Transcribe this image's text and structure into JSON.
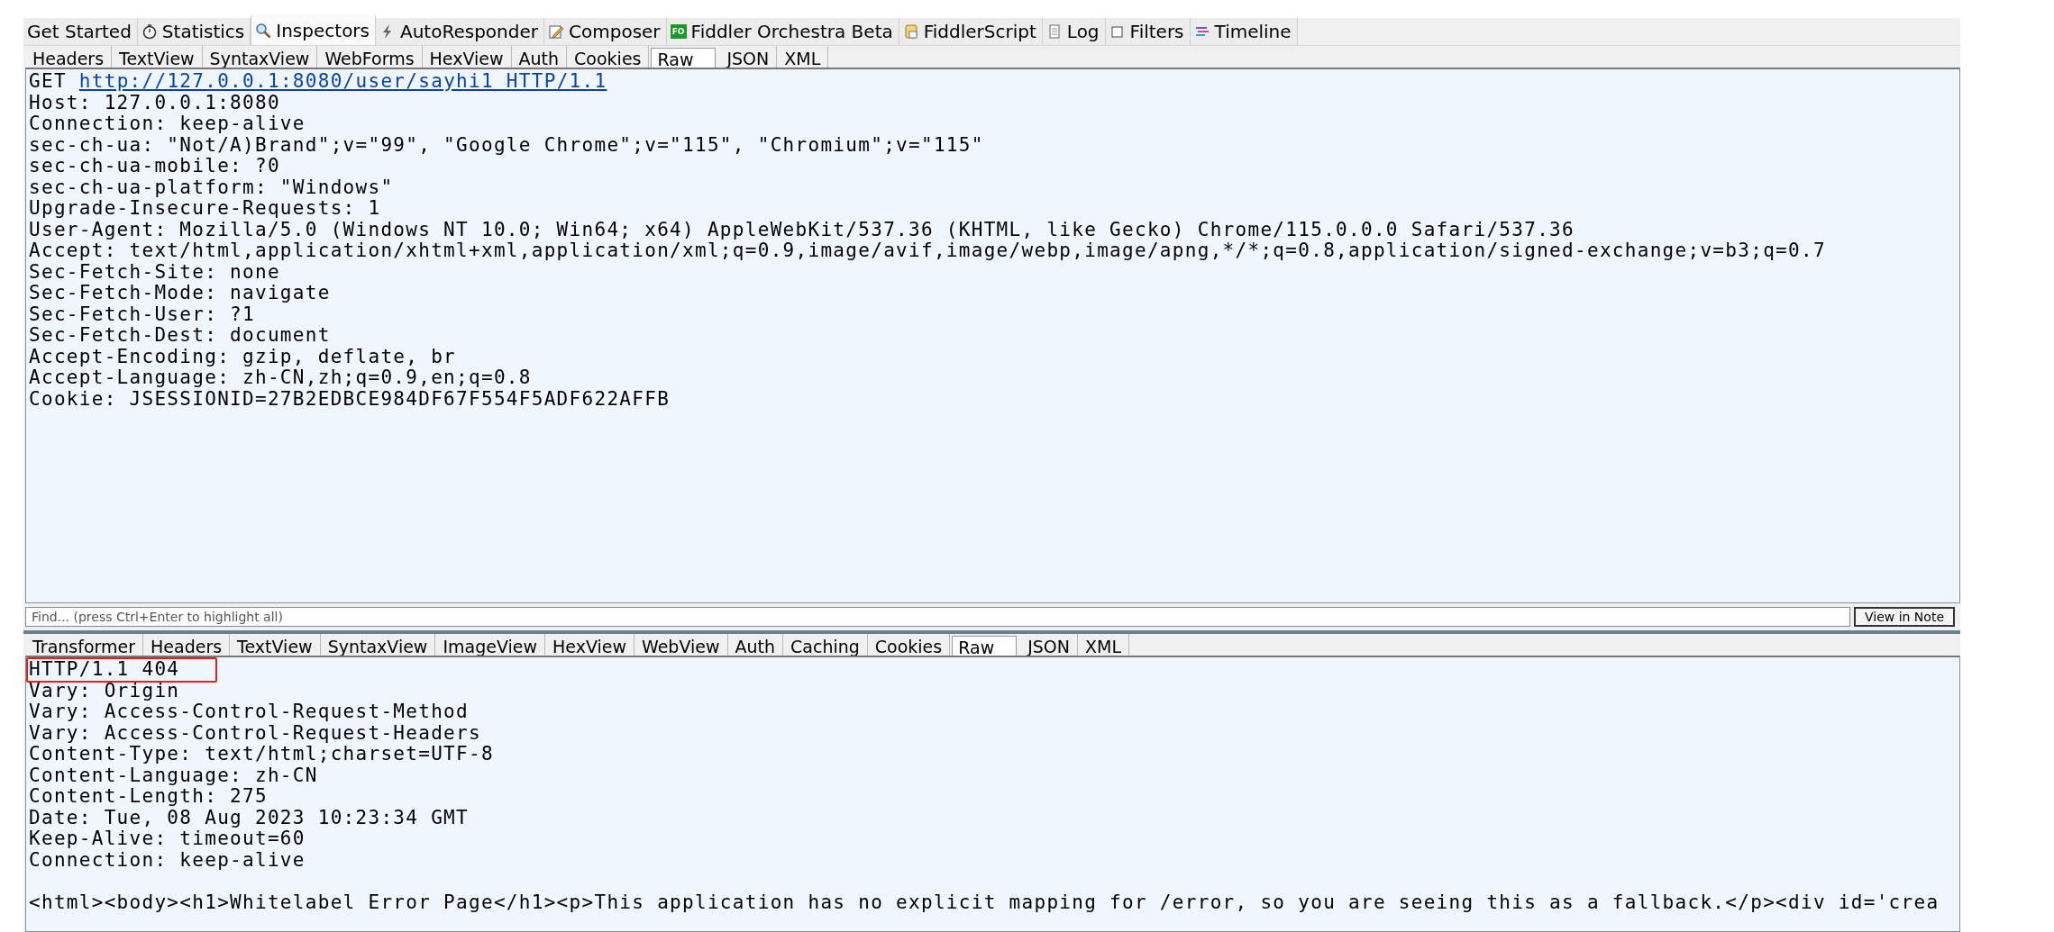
{
  "main_tabs": [
    {
      "label": "Get Started",
      "selected": false
    },
    {
      "label": "Statistics",
      "selected": false
    },
    {
      "label": "Inspectors",
      "selected": true
    },
    {
      "label": "AutoResponder",
      "selected": false
    },
    {
      "label": "Composer",
      "selected": false
    },
    {
      "label": "Fiddler Orchestra Beta",
      "icon_text": "FO",
      "selected": false
    },
    {
      "label": "FiddlerScript",
      "selected": false
    },
    {
      "label": "Log",
      "selected": false
    },
    {
      "label": "Filters",
      "selected": false
    },
    {
      "label": "Timeline",
      "selected": false
    }
  ],
  "request": {
    "tabs": [
      {
        "label": "Headers",
        "selected": false
      },
      {
        "label": "TextView",
        "selected": false
      },
      {
        "label": "SyntaxView",
        "selected": false
      },
      {
        "label": "WebForms",
        "selected": false
      },
      {
        "label": "HexView",
        "selected": false
      },
      {
        "label": "Auth",
        "selected": false
      },
      {
        "label": "Cookies",
        "selected": false
      },
      {
        "label": "Raw",
        "selected": true
      },
      {
        "label": "JSON",
        "selected": false
      },
      {
        "label": "XML",
        "selected": false
      }
    ],
    "method": "GET",
    "url": "http://127.0.0.1:8080/user/sayhi1 HTTP/1.1",
    "headers": [
      "Host: 127.0.0.1:8080",
      "Connection: keep-alive",
      "sec-ch-ua: \"Not/A)Brand\";v=\"99\", \"Google Chrome\";v=\"115\", \"Chromium\";v=\"115\"",
      "sec-ch-ua-mobile: ?0",
      "sec-ch-ua-platform: \"Windows\"",
      "Upgrade-Insecure-Requests: 1",
      "User-Agent: Mozilla/5.0 (Windows NT 10.0; Win64; x64) AppleWebKit/537.36 (KHTML, like Gecko) Chrome/115.0.0.0 Safari/537.36",
      "Accept: text/html,application/xhtml+xml,application/xml;q=0.9,image/avif,image/webp,image/apng,*/*;q=0.8,application/signed-exchange;v=b3;q=0.7",
      "Sec-Fetch-Site: none",
      "Sec-Fetch-Mode: navigate",
      "Sec-Fetch-User: ?1",
      "Sec-Fetch-Dest: document",
      "Accept-Encoding: gzip, deflate, br",
      "Accept-Language: zh-CN,zh;q=0.9,en;q=0.8",
      "Cookie: JSESSIONID=27B2EDBCE984DF67F554F5ADF622AFFB"
    ]
  },
  "find_bar": {
    "placeholder": "Find... (press Ctrl+Enter to highlight all)",
    "button": "View in Note"
  },
  "response": {
    "tabs": [
      {
        "label": "Transformer",
        "selected": false
      },
      {
        "label": "Headers",
        "selected": false
      },
      {
        "label": "TextView",
        "selected": false
      },
      {
        "label": "SyntaxView",
        "selected": false
      },
      {
        "label": "ImageView",
        "selected": false
      },
      {
        "label": "HexView",
        "selected": false
      },
      {
        "label": "WebView",
        "selected": false
      },
      {
        "label": "Auth",
        "selected": false
      },
      {
        "label": "Caching",
        "selected": false
      },
      {
        "label": "Cookies",
        "selected": false
      },
      {
        "label": "Raw",
        "selected": true
      },
      {
        "label": "JSON",
        "selected": false
      },
      {
        "label": "XML",
        "selected": false
      }
    ],
    "status_line": {
      "text": "HTTP/1.1 404",
      "highlighted": true
    },
    "headers": [
      "Vary: Origin",
      "Vary: Access-Control-Request-Method",
      "Vary: Access-Control-Request-Headers",
      "Content-Type: text/html;charset=UTF-8",
      "Content-Language: zh-CN",
      "Content-Length: 275",
      "Date: Tue, 08 Aug 2023 10:23:34 GMT",
      "Keep-Alive: timeout=60",
      "Connection: keep-alive"
    ],
    "body": "<html><body><h1>Whitelabel Error Page</h1><p>This application has no explicit mapping for /error, so you are seeing this as a fallback.</p><div id='crea"
  }
}
